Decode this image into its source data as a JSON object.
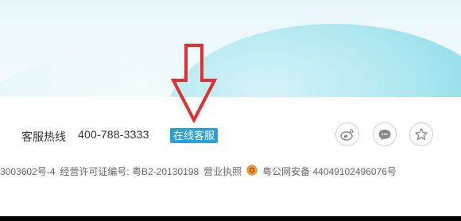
{
  "contact": {
    "hotline_label": "客服热线",
    "hotline_number": "400-788-3333",
    "online_service": "在线客服"
  },
  "social": [
    {
      "icon": "weibo-icon"
    },
    {
      "icon": "wechat-icon"
    },
    {
      "icon": "star-icon"
    }
  ],
  "license": {
    "icp": "3003602号-4",
    "permit": "经营许可证编号: 粤B2-20130198",
    "business_license": "营业执照",
    "police_record": "粤公网安备 44049102496076号"
  },
  "colors": {
    "accent": "#2b9fd8",
    "arrow": "#e03030"
  }
}
